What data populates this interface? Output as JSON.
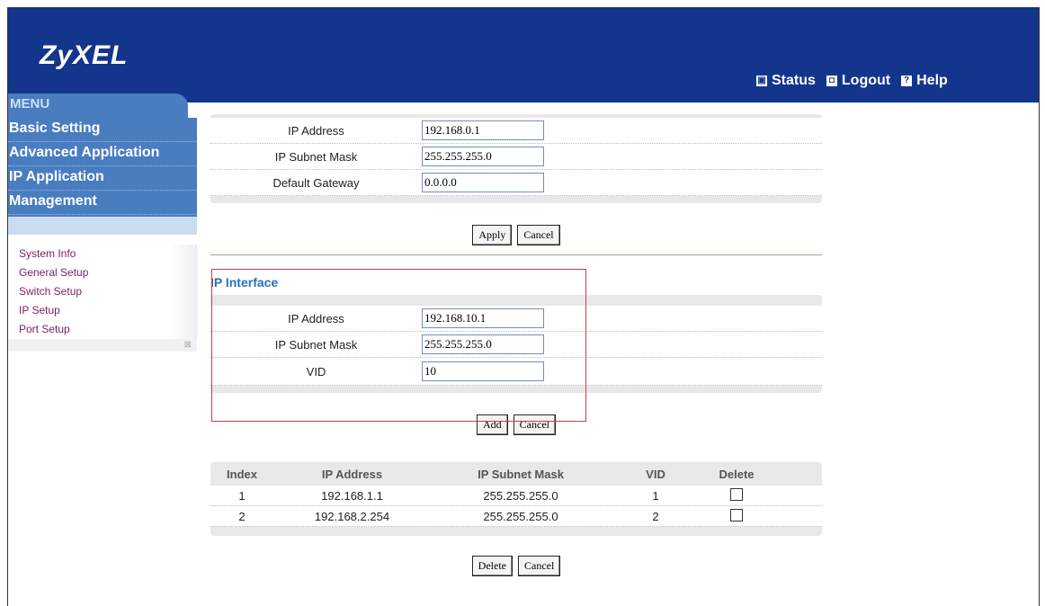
{
  "brand": "ZyXEL",
  "top_links": [
    {
      "label": "Status",
      "icon": "status-icon"
    },
    {
      "label": "Logout",
      "icon": "logout-icon"
    },
    {
      "label": "Help",
      "icon": "help-icon"
    }
  ],
  "menu": {
    "title": "MENU",
    "main_items": [
      "Basic Setting",
      "Advanced Application",
      "IP Application",
      "Management"
    ],
    "sub_items": [
      "System Info",
      "General Setup",
      "Switch Setup",
      "IP Setup",
      "Port Setup"
    ]
  },
  "mgmt": {
    "rows": [
      {
        "label": "IP Address",
        "value": "192.168.0.1"
      },
      {
        "label": "IP Subnet Mask",
        "value": "255.255.255.0"
      },
      {
        "label": "Default Gateway",
        "value": "0.0.0.0"
      }
    ],
    "apply": "Apply",
    "cancel": "Cancel"
  },
  "ip_interface": {
    "title": "IP Interface",
    "rows": [
      {
        "label": "IP Address",
        "value": "192.168.10.1"
      },
      {
        "label": "IP Subnet Mask",
        "value": "255.255.255.0"
      },
      {
        "label": "VID",
        "value": "10"
      }
    ],
    "add": "Add",
    "cancel": "Cancel"
  },
  "table": {
    "headers": [
      "Index",
      "IP Address",
      "IP Subnet Mask",
      "VID",
      "Delete"
    ],
    "rows": [
      {
        "index": "1",
        "ip": "192.168.1.1",
        "mask": "255.255.255.0",
        "vid": "1"
      },
      {
        "index": "2",
        "ip": "192.168.2.254",
        "mask": "255.255.255.0",
        "vid": "2"
      }
    ],
    "delete": "Delete",
    "cancel": "Cancel"
  },
  "colors": {
    "header": "#13358c",
    "menu": "#4a7cc0",
    "section_title": "#2a6fb0",
    "highlight_box": "#d23c3c"
  }
}
